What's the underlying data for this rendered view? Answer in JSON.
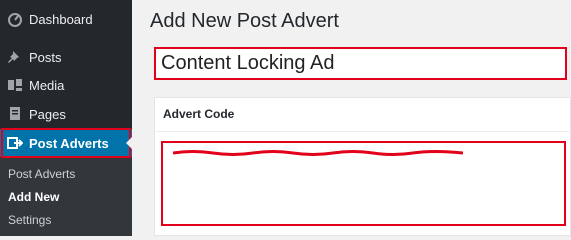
{
  "sidebar": {
    "items": [
      {
        "label": "Dashboard",
        "icon": "dashboard-icon"
      },
      {
        "label": "Posts",
        "icon": "pin-icon"
      },
      {
        "label": "Media",
        "icon": "media-icon"
      },
      {
        "label": "Pages",
        "icon": "pages-icon"
      },
      {
        "label": "Post Adverts",
        "icon": "advert-icon",
        "active": true
      }
    ],
    "submenu": [
      {
        "label": "Post Adverts"
      },
      {
        "label": "Add New",
        "current": true
      },
      {
        "label": "Settings"
      }
    ]
  },
  "main": {
    "page_title": "Add New Post Advert",
    "title_field": {
      "value": "Content Locking Ad"
    },
    "advert_code": {
      "label": "Advert Code"
    }
  },
  "colors": {
    "sidebar_bg": "#23282d",
    "submenu_bg": "#32373c",
    "active_bg": "#0073aa",
    "highlight_red": "#e2001a",
    "page_bg": "#f1f1f1"
  }
}
